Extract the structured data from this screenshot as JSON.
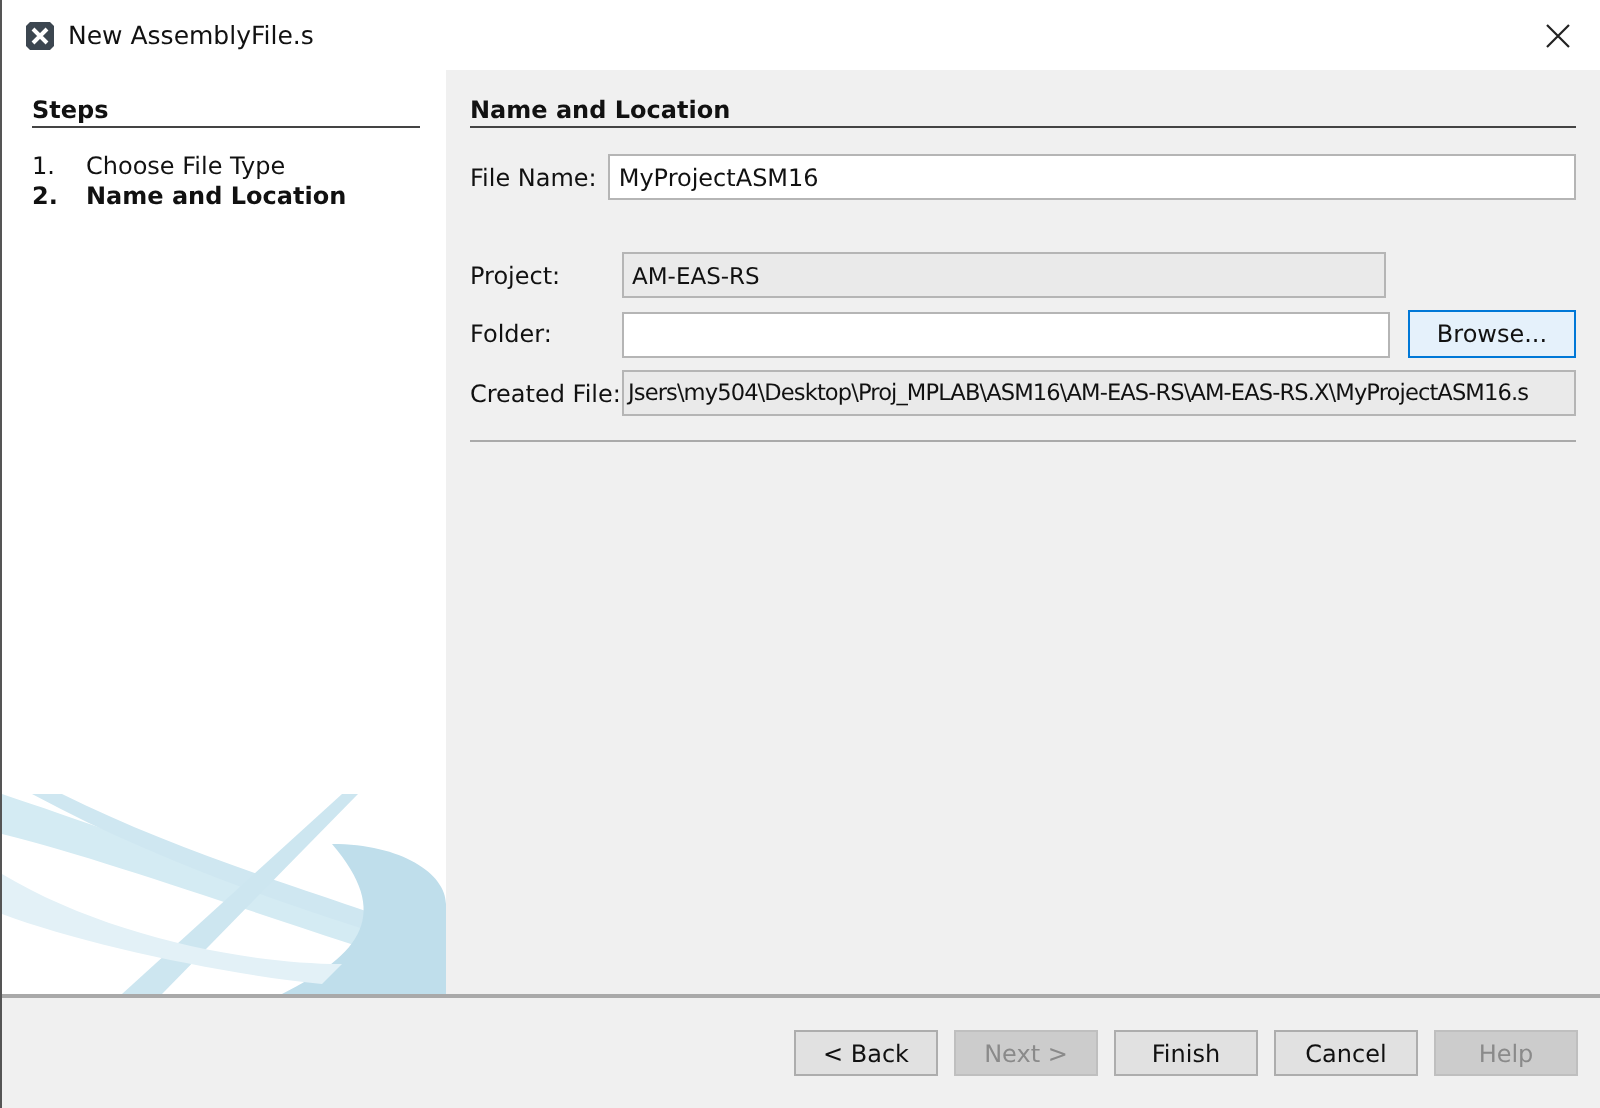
{
  "window": {
    "title": "New AssemblyFile.s"
  },
  "steps": {
    "title": "Steps",
    "items": [
      {
        "number": "1.",
        "label": "Choose File Type",
        "selected": false
      },
      {
        "number": "2.",
        "label": "Name and Location",
        "selected": true
      }
    ]
  },
  "panel": {
    "title": "Name and Location",
    "fields": [
      {
        "kind": "editable",
        "label": "File Name:",
        "value": "MyProjectASM16"
      },
      {
        "kind": "readonly",
        "label": "Project:",
        "value": "AM-EAS-RS"
      },
      {
        "kind": "browse",
        "label": "Folder:",
        "button": "Browse..."
      },
      {
        "kind": "readonly",
        "label": "Created File:",
        "value": "Jsers\\my504\\Desktop\\Proj_MPLAB\\ASM16\\AM-EAS-RS\\AM-EAS-RS.X\\MyProjectASM16.s"
      }
    ]
  },
  "buttons": [
    {
      "label": "< Back",
      "disabled": false
    },
    {
      "label": "Next >",
      "disabled": true
    },
    {
      "label": "Finish",
      "disabled": false
    },
    {
      "label": "Cancel",
      "disabled": false
    },
    {
      "label": "Help",
      "disabled": true
    }
  ]
}
